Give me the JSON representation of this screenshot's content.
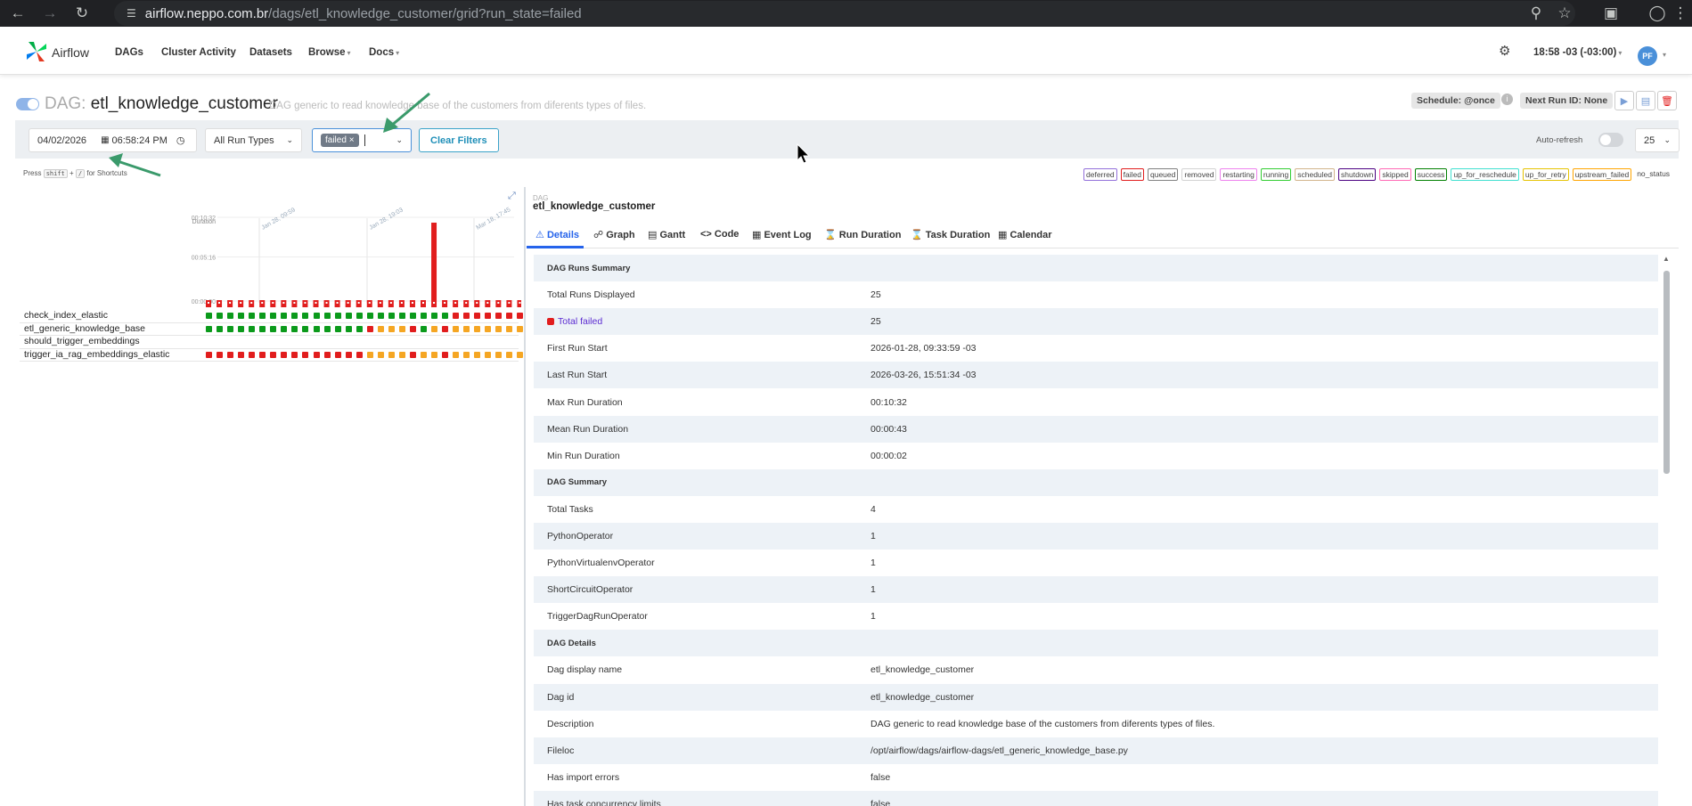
{
  "browser": {
    "url_host": "airflow.neppo.com.br",
    "url_path": "/dags/etl_knowledge_customer/grid?run_state=failed"
  },
  "navbar": {
    "brand": "Airflow",
    "items": [
      "DAGs",
      "Cluster Activity",
      "Datasets",
      "Browse",
      "Docs"
    ],
    "time": "18:58 -03 (-03:00)",
    "avatar": "PF"
  },
  "dag_header": {
    "label": "DAG:",
    "name": "etl_knowledge_customer",
    "description": "DAG generic to read knowledge base of the customers from diferents types of files.",
    "schedule": "Schedule: @once",
    "next_run": "Next Run ID: None"
  },
  "filters": {
    "date": "04/02/2026",
    "time": "06:58:24 PM",
    "run_types": "All Run Types",
    "state_chip": "failed",
    "clear_label": "Clear Filters",
    "autorefresh_label": "Auto-refresh",
    "num_runs": "25"
  },
  "shortcut": {
    "press": "Press",
    "key1": "shift",
    "plus": "+",
    "key2": "/",
    "suffix": "for Shortcuts"
  },
  "legend": [
    {
      "label": "deferred",
      "color": "#9370db"
    },
    {
      "label": "failed",
      "color": "#e11d1d"
    },
    {
      "label": "queued",
      "color": "#808080"
    },
    {
      "label": "removed",
      "color": "#d3d3d3"
    },
    {
      "label": "restarting",
      "color": "#ee82ee"
    },
    {
      "label": "running",
      "color": "#32cd32"
    },
    {
      "label": "scheduled",
      "color": "#d2b48c"
    },
    {
      "label": "shutdown",
      "color": "#4b0082"
    },
    {
      "label": "skipped",
      "color": "#ff69b4"
    },
    {
      "label": "success",
      "color": "#008000"
    },
    {
      "label": "up_for_reschedule",
      "color": "#40e0d0"
    },
    {
      "label": "up_for_retry",
      "color": "#e6c300"
    },
    {
      "label": "upstream_failed",
      "color": "#ffa500"
    },
    {
      "label": "no_status",
      "color": "#ffffff"
    }
  ],
  "grid": {
    "duration_label": "Duration",
    "y_ticks": [
      "00:10:32",
      "00:05:16",
      "00:00:00"
    ],
    "date_labels": [
      "Jan 28, 09:59",
      "Jan 28, 19:03",
      "Mar 18, 17:45"
    ],
    "run_durations_s": [
      2,
      2,
      2,
      2,
      2,
      2,
      2,
      2,
      2,
      2,
      2,
      2,
      2,
      2,
      2,
      2,
      2,
      2,
      2,
      40,
      2,
      632,
      2,
      2,
      2,
      2,
      2,
      2,
      2,
      2
    ],
    "tasks": [
      {
        "name": "check_index_elastic",
        "states": [
          "success",
          "success",
          "success",
          "success",
          "success",
          "success",
          "success",
          "success",
          "success",
          "success",
          "success",
          "success",
          "success",
          "success",
          "success",
          "success",
          "success",
          "success",
          "success",
          "success",
          "success",
          "success",
          "success",
          "failed",
          "failed",
          "failed",
          "failed",
          "failed",
          "failed",
          "failed"
        ]
      },
      {
        "name": "etl_generic_knowledge_base",
        "states": [
          "success",
          "success",
          "success",
          "success",
          "success",
          "success",
          "success",
          "success",
          "success",
          "success",
          "success",
          "success",
          "success",
          "success",
          "success",
          "failed",
          "upstream_failed",
          "upstream_failed",
          "upstream_failed",
          "failed",
          "success",
          "upstream_failed",
          "failed",
          "upstream_failed",
          "upstream_failed",
          "upstream_failed",
          "upstream_failed",
          "upstream_failed",
          "upstream_failed",
          "upstream_failed"
        ]
      },
      {
        "name": "should_trigger_embeddings",
        "states": []
      },
      {
        "name": "trigger_ia_rag_embeddings_elastic",
        "states": [
          "failed",
          "failed",
          "failed",
          "failed",
          "failed",
          "failed",
          "failed",
          "failed",
          "failed",
          "failed",
          "failed",
          "failed",
          "failed",
          "failed",
          "failed",
          "upstream_failed",
          "upstream_failed",
          "upstream_failed",
          "upstream_failed",
          "failed",
          "upstream_failed",
          "upstream_failed",
          "failed",
          "upstream_failed",
          "upstream_failed",
          "upstream_failed",
          "upstream_failed",
          "upstream_failed",
          "upstream_failed",
          "upstream_failed"
        ]
      }
    ]
  },
  "details": {
    "kicker": "DAG",
    "dag_name": "etl_knowledge_customer",
    "tabs": [
      "Details",
      "Graph",
      "Gantt",
      "Code",
      "Event Log",
      "Run Duration",
      "Task Duration",
      "Calendar"
    ],
    "rows": [
      {
        "type": "section",
        "label": "DAG Runs Summary",
        "value": ""
      },
      {
        "type": "row",
        "label": "Total Runs Displayed",
        "value": "25"
      },
      {
        "type": "failed",
        "label": "Total failed",
        "value": "25"
      },
      {
        "type": "row",
        "label": "First Run Start",
        "value": "2026-01-28, 09:33:59 -03"
      },
      {
        "type": "row",
        "label": "Last Run Start",
        "value": "2026-03-26, 15:51:34 -03"
      },
      {
        "type": "row",
        "label": "Max Run Duration",
        "value": "00:10:32"
      },
      {
        "type": "row",
        "label": "Mean Run Duration",
        "value": "00:00:43"
      },
      {
        "type": "row",
        "label": "Min Run Duration",
        "value": "00:00:02"
      },
      {
        "type": "section",
        "label": "DAG Summary",
        "value": ""
      },
      {
        "type": "row",
        "label": "Total Tasks",
        "value": "4"
      },
      {
        "type": "row",
        "label": "PythonOperator",
        "value": "1"
      },
      {
        "type": "row",
        "label": "PythonVirtualenvOperator",
        "value": "1"
      },
      {
        "type": "row",
        "label": "ShortCircuitOperator",
        "value": "1"
      },
      {
        "type": "row",
        "label": "TriggerDagRunOperator",
        "value": "1"
      },
      {
        "type": "section",
        "label": "DAG Details",
        "value": ""
      },
      {
        "type": "row",
        "label": "Dag display name",
        "value": "etl_knowledge_customer"
      },
      {
        "type": "row",
        "label": "Dag id",
        "value": "etl_knowledge_customer"
      },
      {
        "type": "row",
        "label": "Description",
        "value": "DAG generic to read knowledge base of the customers from diferents types of files."
      },
      {
        "type": "row",
        "label": "Fileloc",
        "value": "/opt/airflow/dags/airflow-dags/etl_generic_knowledge_base.py"
      },
      {
        "type": "row",
        "label": "Has import errors",
        "value": "false"
      },
      {
        "type": "row",
        "label": "Has task concurrency limits",
        "value": "false"
      }
    ]
  },
  "colors": {
    "success": "#0b9a1b",
    "failed": "#e11d1d",
    "upstream_failed": "#f5a623",
    "annotation_arrow": "#3a9a6b"
  }
}
